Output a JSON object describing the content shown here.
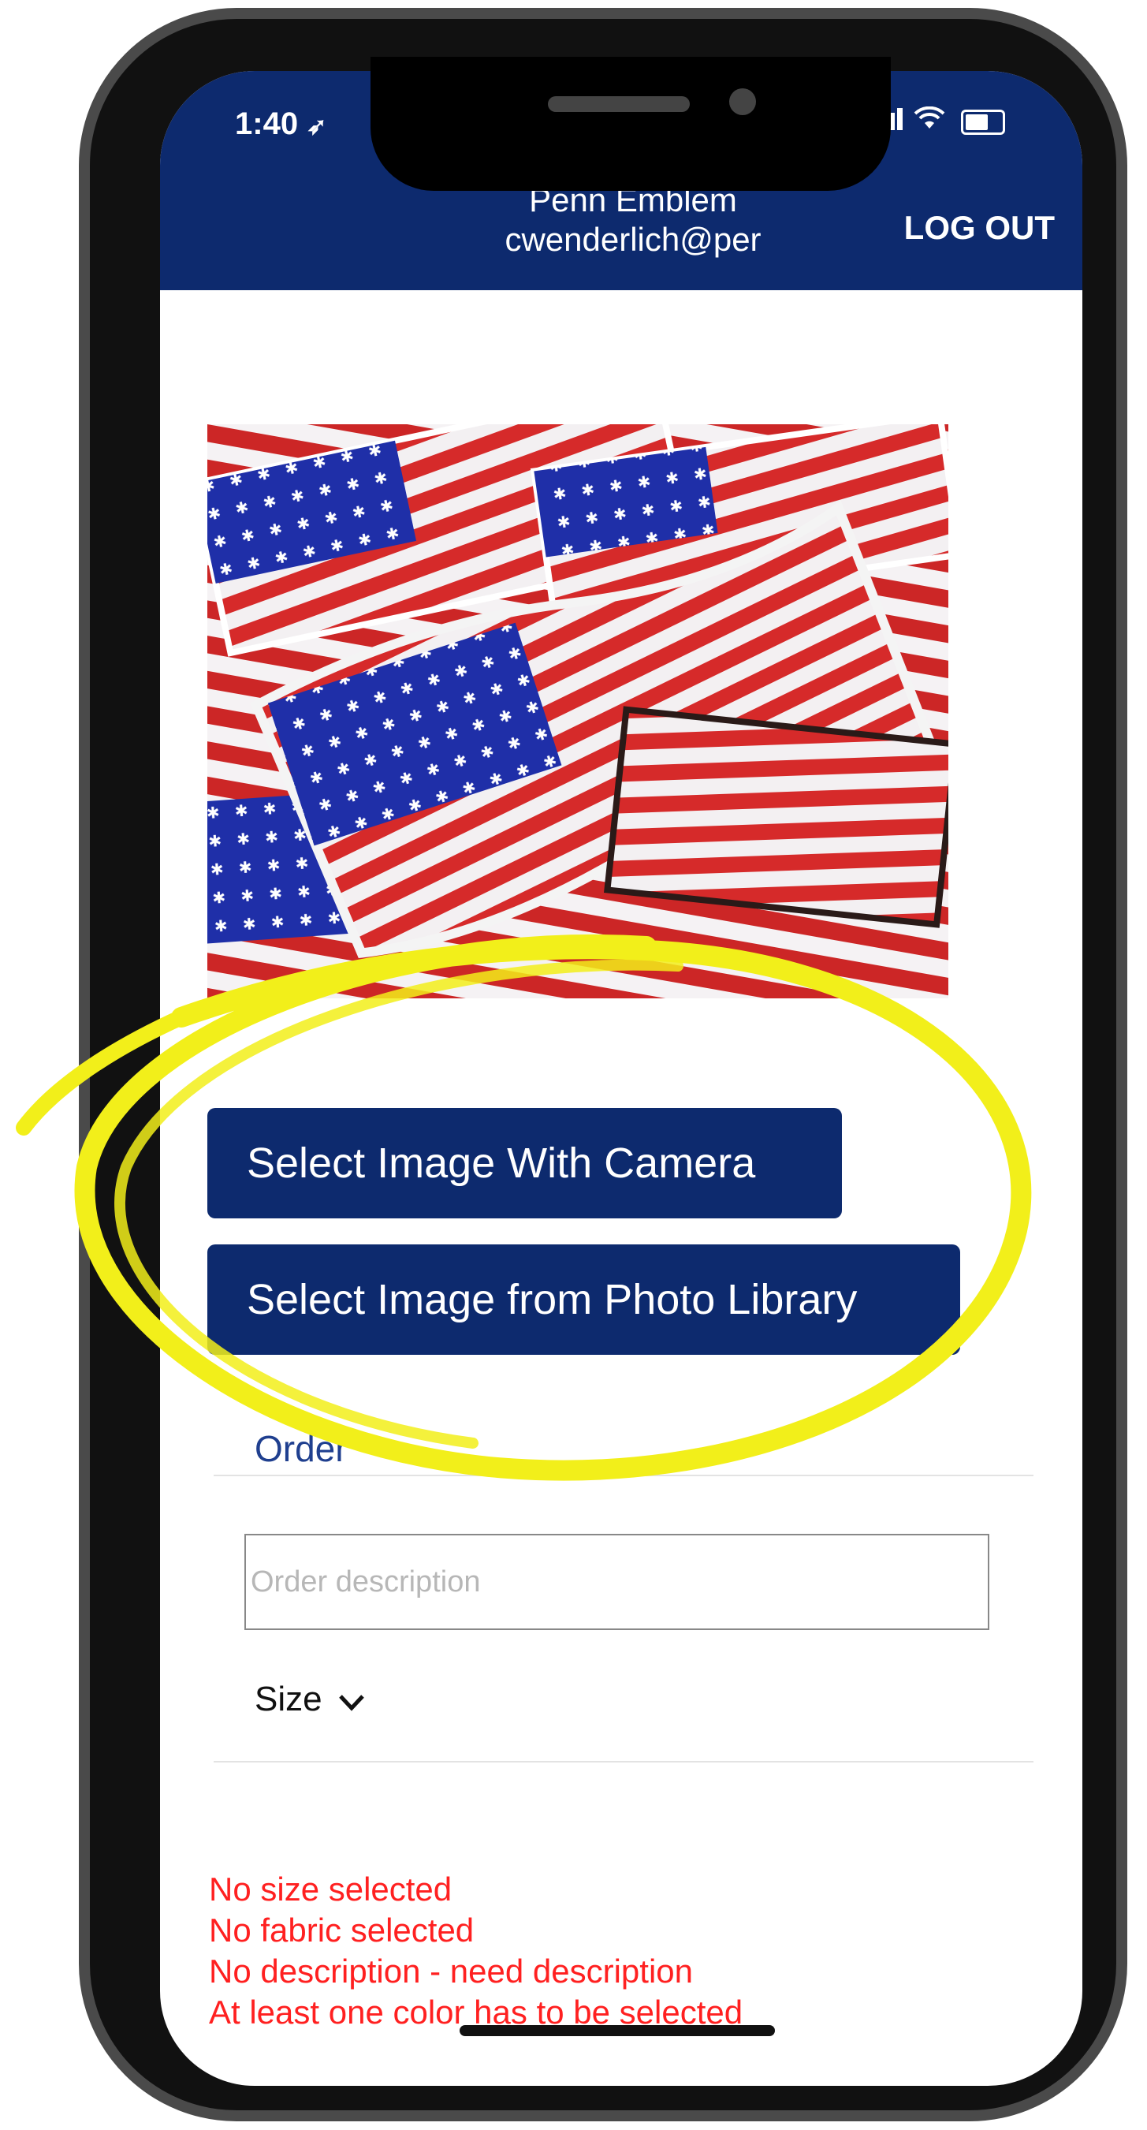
{
  "status_bar": {
    "time": "1:40"
  },
  "header": {
    "org_name": "Penn Emblem",
    "user_email": "cwenderlich@per",
    "logout_label": "LOG OUT"
  },
  "buttons": {
    "camera_label": "Select Image With Camera",
    "library_label": "Select Image from Photo Library"
  },
  "form": {
    "order_label": "Order",
    "description_placeholder": "Order description",
    "size_label": "Size"
  },
  "errors": [
    "No size selected",
    "No fabric selected",
    "No description - need description",
    "At least one color has to be selected"
  ],
  "colors": {
    "header_bg": "#0d2a6e",
    "button_bg": "#0d2a6e",
    "error_text": "#ff2020",
    "highlight": "#f2ef1a"
  }
}
